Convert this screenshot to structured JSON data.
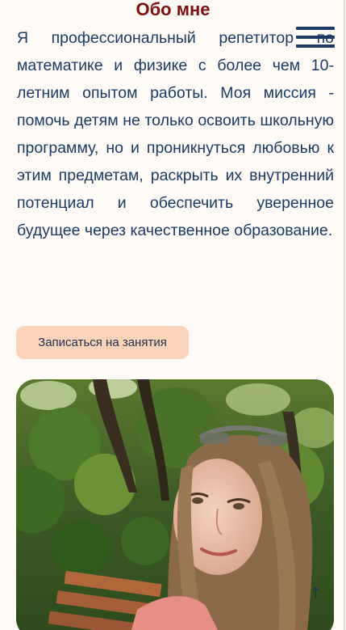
{
  "about": {
    "title": "Обо мне",
    "text": "Я профессиональный репетитор по математике и физике с более чем 10-летним опытом работы. Моя миссия - помочь детям не только освоить школьную программу, но и проникнуться любовью к этим предметам, раскрыть их внутренний потенциал и обеспечить уверенное будущее через качественное образование.",
    "cta_label": "Записаться на занятия"
  },
  "icons": {
    "menu": "hamburger-menu-icon",
    "scroll_top": "arrow-up-icon",
    "scroll_top_glyph": "↑"
  },
  "colors": {
    "title": "#7d0f0f",
    "text": "#1a3a66",
    "button_bg": "#fbd3b9",
    "menu": "#1c3a68",
    "background": "#fffcf7"
  }
}
